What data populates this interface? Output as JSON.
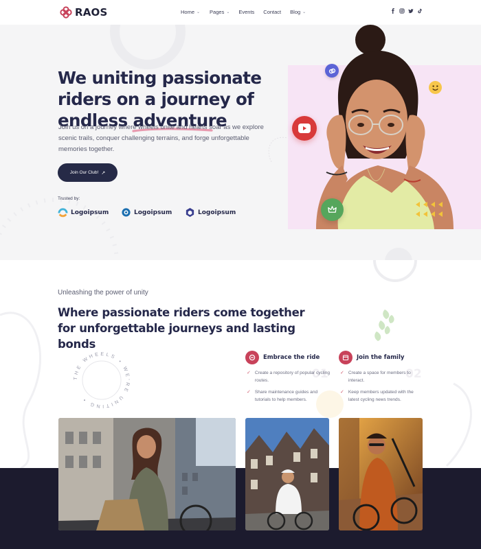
{
  "brand": {
    "name": "RAOS",
    "accent": "#c8425a",
    "dark": "#25284a"
  },
  "nav": {
    "items": [
      {
        "label": "Home",
        "has_dropdown": true
      },
      {
        "label": "Pages",
        "has_dropdown": true
      },
      {
        "label": "Events",
        "has_dropdown": false
      },
      {
        "label": "Contact",
        "has_dropdown": false
      },
      {
        "label": "Blog",
        "has_dropdown": true
      }
    ],
    "social_icons": [
      "facebook-icon",
      "instagram-icon",
      "twitter-icon",
      "tiktok-icon"
    ]
  },
  "hero": {
    "title_main": "We uniting passionate riders on a journey of endless ",
    "title_highlight": "adventure",
    "description": "Join us on a journey where wheels unite and hearts soar as we explore scenic trails, conquer challenging terrains, and forge unforgettable memories together.",
    "cta_label": "Join Our Club!",
    "trusted_label": "Trusted by:",
    "partners": [
      "Logoipsum",
      "Logoipsum",
      "Logoipsum"
    ],
    "badges": [
      "link-icon",
      "smile-emoji-icon",
      "play-icon",
      "crown-icon"
    ]
  },
  "about": {
    "kicker": "Unleashing the power of unity",
    "title": "Where passionate riders come together for unforgettable journeys and lasting bonds",
    "ring_text": "THE WHEELS • WE'RE UNITING •",
    "features": [
      {
        "number": "01",
        "title": "Embrace the ride",
        "items": [
          "Create a repository of popular cycling routes.",
          "Share maintenance guides and tutorials to help members."
        ]
      },
      {
        "number": "02",
        "title": "Join the family",
        "items": [
          "Create a space for members to interact.",
          "Keep members updated with the latest cycling news trends."
        ]
      }
    ]
  }
}
